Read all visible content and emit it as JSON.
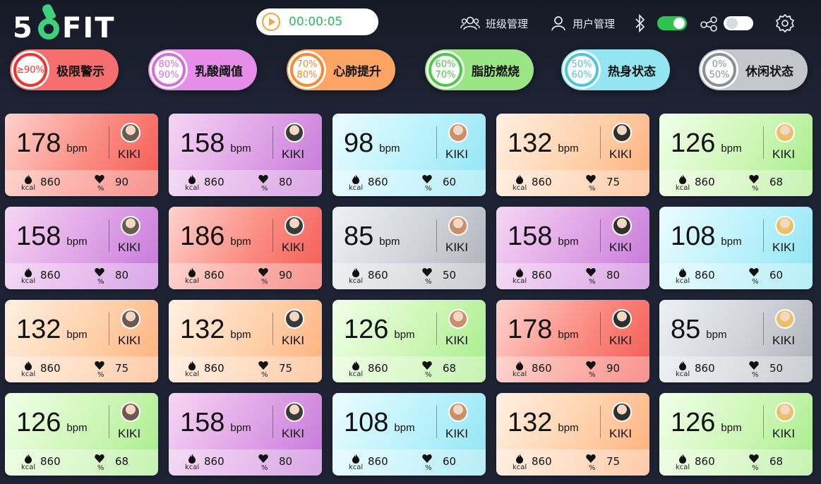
{
  "app": {
    "logo_text_five": "5",
    "logo_text_fit": "FIT"
  },
  "timer": {
    "time": "00:00:05"
  },
  "header": {
    "class_mgmt": "班级管理",
    "user_mgmt": "用户管理",
    "bluetooth_on": true,
    "share_on": false
  },
  "zones": [
    {
      "label": "极限警示",
      "pct_top": "≥90%",
      "pct_bottom": "",
      "color": "#f0342e",
      "pill_color": "#f66e6e"
    },
    {
      "label": "乳酸阈值",
      "pct_top": "80%",
      "pct_bottom": "90%",
      "color": "#d56fe0",
      "pill_color": "#e58de9"
    },
    {
      "label": "心肺提升",
      "pct_top": "70%",
      "pct_bottom": "80%",
      "color": "#f48c34",
      "pill_color": "#fba463"
    },
    {
      "label": "脂肪燃烧",
      "pct_top": "60%",
      "pct_bottom": "70%",
      "color": "#4cc94a",
      "pill_color": "#9be684"
    },
    {
      "label": "热身状态",
      "pct_top": "50%",
      "pct_bottom": "60%",
      "color": "#4cc7dd",
      "pill_color": "#93e6f1"
    },
    {
      "label": "休闲状态",
      "pct_top": "0%",
      "pct_bottom": "50%",
      "color": "#8c8f96",
      "pill_color": "#c4c6cb"
    }
  ],
  "units": {
    "bpm": "bpm",
    "kcal": "kcal",
    "pct": "%"
  },
  "cards": [
    {
      "bpm": "178",
      "name": "KIKI",
      "kcal": "860",
      "pct": "90",
      "zone": "red"
    },
    {
      "bpm": "158",
      "name": "KIKI",
      "kcal": "860",
      "pct": "80",
      "zone": "purple"
    },
    {
      "bpm": "98",
      "name": "KIKI",
      "kcal": "860",
      "pct": "60",
      "zone": "cyan"
    },
    {
      "bpm": "132",
      "name": "KIKI",
      "kcal": "860",
      "pct": "75",
      "zone": "orange"
    },
    {
      "bpm": "126",
      "name": "KIKI",
      "kcal": "860",
      "pct": "68",
      "zone": "green"
    },
    {
      "bpm": "158",
      "name": "KIKI",
      "kcal": "860",
      "pct": "80",
      "zone": "purple"
    },
    {
      "bpm": "186",
      "name": "KIKI",
      "kcal": "860",
      "pct": "90",
      "zone": "red"
    },
    {
      "bpm": "85",
      "name": "KIKI",
      "kcal": "860",
      "pct": "50",
      "zone": "gray"
    },
    {
      "bpm": "158",
      "name": "KIKI",
      "kcal": "860",
      "pct": "80",
      "zone": "purple"
    },
    {
      "bpm": "108",
      "name": "KIKI",
      "kcal": "860",
      "pct": "60",
      "zone": "cyan"
    },
    {
      "bpm": "132",
      "name": "KIKI",
      "kcal": "860",
      "pct": "75",
      "zone": "orange"
    },
    {
      "bpm": "132",
      "name": "KIKI",
      "kcal": "860",
      "pct": "75",
      "zone": "orange"
    },
    {
      "bpm": "126",
      "name": "KIKI",
      "kcal": "860",
      "pct": "68",
      "zone": "green"
    },
    {
      "bpm": "178",
      "name": "KIKI",
      "kcal": "860",
      "pct": "90",
      "zone": "red"
    },
    {
      "bpm": "85",
      "name": "KIKI",
      "kcal": "860",
      "pct": "50",
      "zone": "gray"
    },
    {
      "bpm": "126",
      "name": "KIKI",
      "kcal": "860",
      "pct": "68",
      "zone": "green"
    },
    {
      "bpm": "158",
      "name": "KIKI",
      "kcal": "860",
      "pct": "80",
      "zone": "purple"
    },
    {
      "bpm": "108",
      "name": "KIKI",
      "kcal": "860",
      "pct": "60",
      "zone": "cyan"
    },
    {
      "bpm": "132",
      "name": "KIKI",
      "kcal": "860",
      "pct": "75",
      "zone": "orange"
    },
    {
      "bpm": "126",
      "name": "KIKI",
      "kcal": "860",
      "pct": "68",
      "zone": "green"
    }
  ]
}
